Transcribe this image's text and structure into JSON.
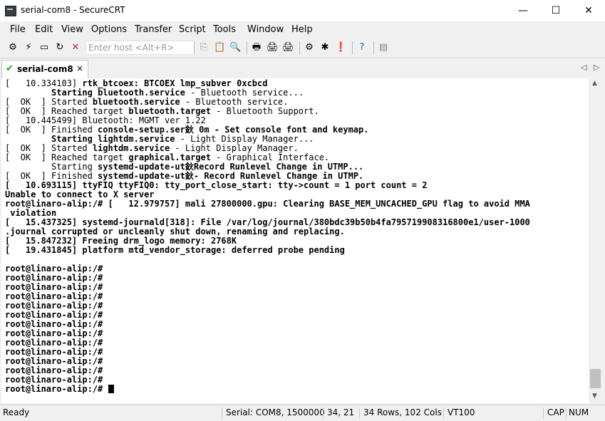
{
  "window": {
    "title": "serial-com8 - SecureCRT",
    "minimize": "—",
    "maximize": "☐",
    "close": "✕"
  },
  "menu": [
    "File",
    "Edit",
    "View",
    "Options",
    "Transfer",
    "Script",
    "Tools",
    "Window",
    "Help"
  ],
  "toolbar": {
    "host_placeholder": "Enter host <Alt+R>",
    "host_value": ""
  },
  "tab": {
    "label": "serial-com8",
    "close": "×"
  },
  "terminal": {
    "lines": [
      [
        {
          "t": "[   10.334103] "
        },
        {
          "t": "rtk_btcoex: BTCOEX lmp_subver 0xcbcd",
          "b": true
        }
      ],
      [
        {
          "t": "         "
        },
        {
          "t": "Starting ",
          "b": true
        },
        {
          "t": "bluetooth.service",
          "b": true
        },
        {
          "t": " - Bluetooth service..."
        }
      ],
      [
        {
          "t": "[  OK  ] Started "
        },
        {
          "t": "bluetooth.service",
          "b": true
        },
        {
          "t": " - Bluetooth service."
        }
      ],
      [
        {
          "t": "[  OK  ] Reached target "
        },
        {
          "t": "bluetooth.target",
          "b": true
        },
        {
          "t": " - Bluetooth Support."
        }
      ],
      [
        {
          "t": "[   10.445499] Bluetooth: MGMT ver 1.22"
        }
      ],
      [
        {
          "t": "[  OK  ] Finished "
        },
        {
          "t": "console-setup.ser鈥 0m - Set console font and keymap.",
          "b": true
        }
      ],
      [
        {
          "t": "         "
        },
        {
          "t": "Starting ",
          "b": true
        },
        {
          "t": "lightdm.service",
          "b": true
        },
        {
          "t": " - Light Display Manager..."
        }
      ],
      [
        {
          "t": "[  OK  ] Started "
        },
        {
          "t": "lightdm.service",
          "b": true
        },
        {
          "t": " - Light Display Manager."
        }
      ],
      [
        {
          "t": "[  OK  ] Reached target "
        },
        {
          "t": "graphical.target",
          "b": true
        },
        {
          "t": " - Graphical Interface."
        }
      ],
      [
        {
          "t": "         Starting "
        },
        {
          "t": "systemd-update-ut鈥Record Runlevel Change in UTMP...",
          "b": true
        }
      ],
      [
        {
          "t": "[  OK  ] Finished "
        },
        {
          "t": "systemd-update-ut鈥- Record Runlevel Change in UTMP.",
          "b": true
        }
      ],
      [
        {
          "t": "[   10.693115] ttyFIQ ttyFIQ0: tty_port_close_start: tty->count = 1 port count = 2",
          "b": true
        }
      ],
      [
        {
          "t": "Unable to connect to X server",
          "b": true
        }
      ],
      [
        {
          "t": "root@linaro-alip:/# [   12.979757] mali 27800000.gpu: Clearing BASE_MEM_UNCACHED_GPU flag to avoid MMA",
          "b": true
        }
      ],
      [
        {
          "t": " violation",
          "b": true
        }
      ],
      [
        {
          "t": "[   15.437325] systemd-journald[318]: File /var/log/journal/380bdc39b50b4fa795719908316800e1/user-1000",
          "b": true
        }
      ],
      [
        {
          "t": ".journal corrupted or uncleanly shut down, renaming and replacing.",
          "b": true
        }
      ],
      [
        {
          "t": "[   15.847232] Freeing drm_logo memory: 2768K",
          "b": true
        }
      ],
      [
        {
          "t": "[   19.431845] platform mtd_vendor_storage: deferred probe pending",
          "b": true
        }
      ],
      [
        {
          "t": ""
        }
      ],
      [
        {
          "t": "root@linaro-alip:/#",
          "b": true
        }
      ],
      [
        {
          "t": "root@linaro-alip:/#",
          "b": true
        }
      ],
      [
        {
          "t": "root@linaro-alip:/#",
          "b": true
        }
      ],
      [
        {
          "t": "root@linaro-alip:/#",
          "b": true
        }
      ],
      [
        {
          "t": "root@linaro-alip:/#",
          "b": true
        }
      ],
      [
        {
          "t": "root@linaro-alip:/#",
          "b": true
        }
      ],
      [
        {
          "t": "root@linaro-alip:/#",
          "b": true
        }
      ],
      [
        {
          "t": "root@linaro-alip:/#",
          "b": true
        }
      ],
      [
        {
          "t": "root@linaro-alip:/#",
          "b": true
        }
      ],
      [
        {
          "t": "root@linaro-alip:/#",
          "b": true
        }
      ],
      [
        {
          "t": "root@linaro-alip:/#",
          "b": true
        }
      ],
      [
        {
          "t": "root@linaro-alip:/#",
          "b": true
        }
      ],
      [
        {
          "t": "root@linaro-alip:/#",
          "b": true
        }
      ],
      [
        {
          "t": "root@linaro-alip:/# ",
          "b": true,
          "cursor": true
        }
      ]
    ]
  },
  "status": {
    "ready": "Ready",
    "connection": "Serial: COM8, 1500000",
    "position": "34,  21",
    "size": "34 Rows, 102 Cols",
    "emulation": "VT100",
    "caps": "CAP",
    "num": "NUM"
  }
}
